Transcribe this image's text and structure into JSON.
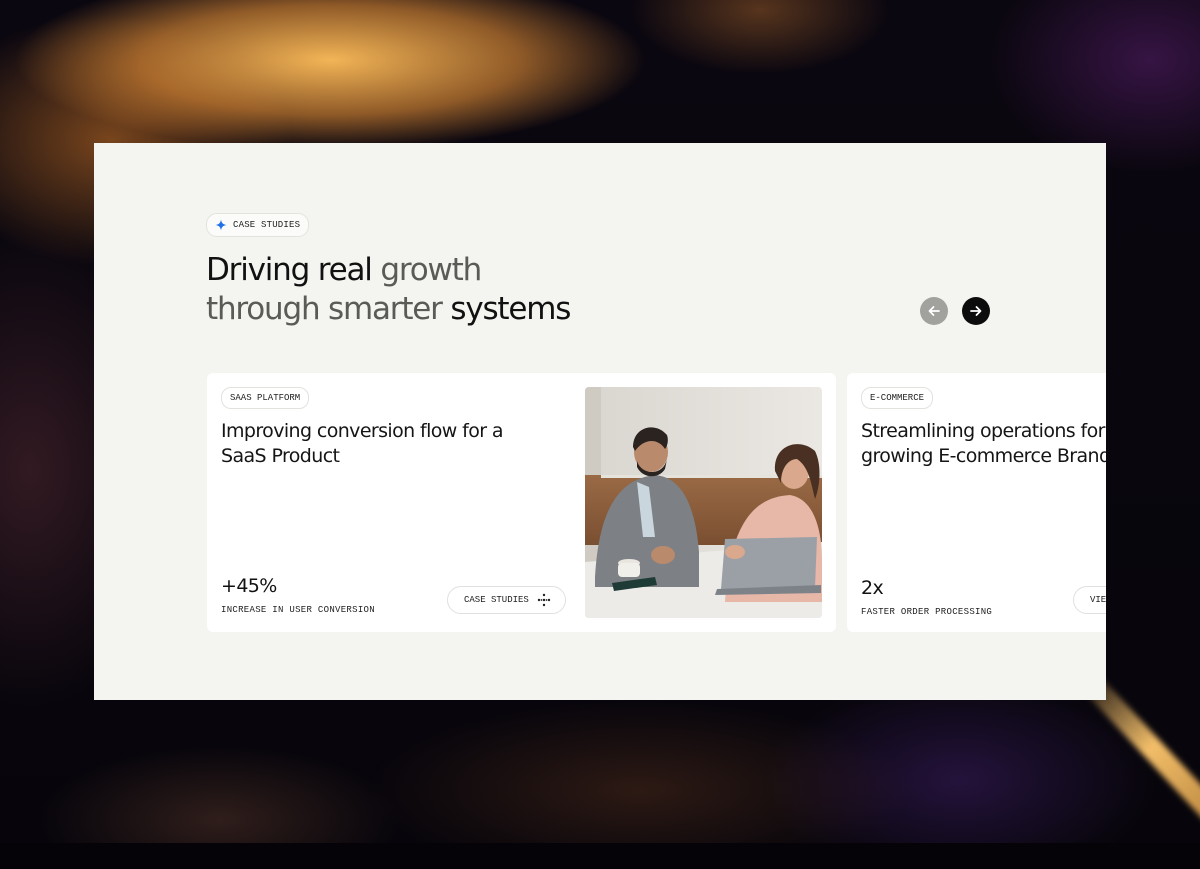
{
  "colors": {
    "panel_bg": "#f4f4f0",
    "card_bg": "#ffffff",
    "text_dark": "#111111",
    "text_muted": "#5a5a56",
    "accent_sparkle": "#1f6feb",
    "nav_prev_bg": "#a1a19e",
    "nav_next_bg": "#0c0c0c"
  },
  "section": {
    "eyebrow_icon": "sparkle-icon",
    "eyebrow_label": "CASE STUDIES",
    "headline": {
      "part1": "Driving real",
      "part2": " growth",
      "part3": "through smarter",
      "part4": " systems"
    }
  },
  "carousel": {
    "prev_icon": "arrow-left-icon",
    "next_icon": "arrow-right-icon",
    "cards": [
      {
        "tag": "SAAS PLATFORM",
        "title": "Improving conversion flow for a SaaS Product",
        "stat_value": "+45%",
        "stat_label": "INCREASE IN USER CONVERSION",
        "cta_label": "CASE STUDIES",
        "cta_icon": "grid-dots-icon",
        "image": "business-meeting-photo"
      },
      {
        "tag": "E-COMMERCE",
        "title_line1": "Streamlining operations for",
        "title_line2": "growing E-commerce Brand",
        "stat_value": "2x",
        "stat_label": "FASTER ORDER PROCESSING",
        "cta_label": "VIEW"
      }
    ]
  }
}
